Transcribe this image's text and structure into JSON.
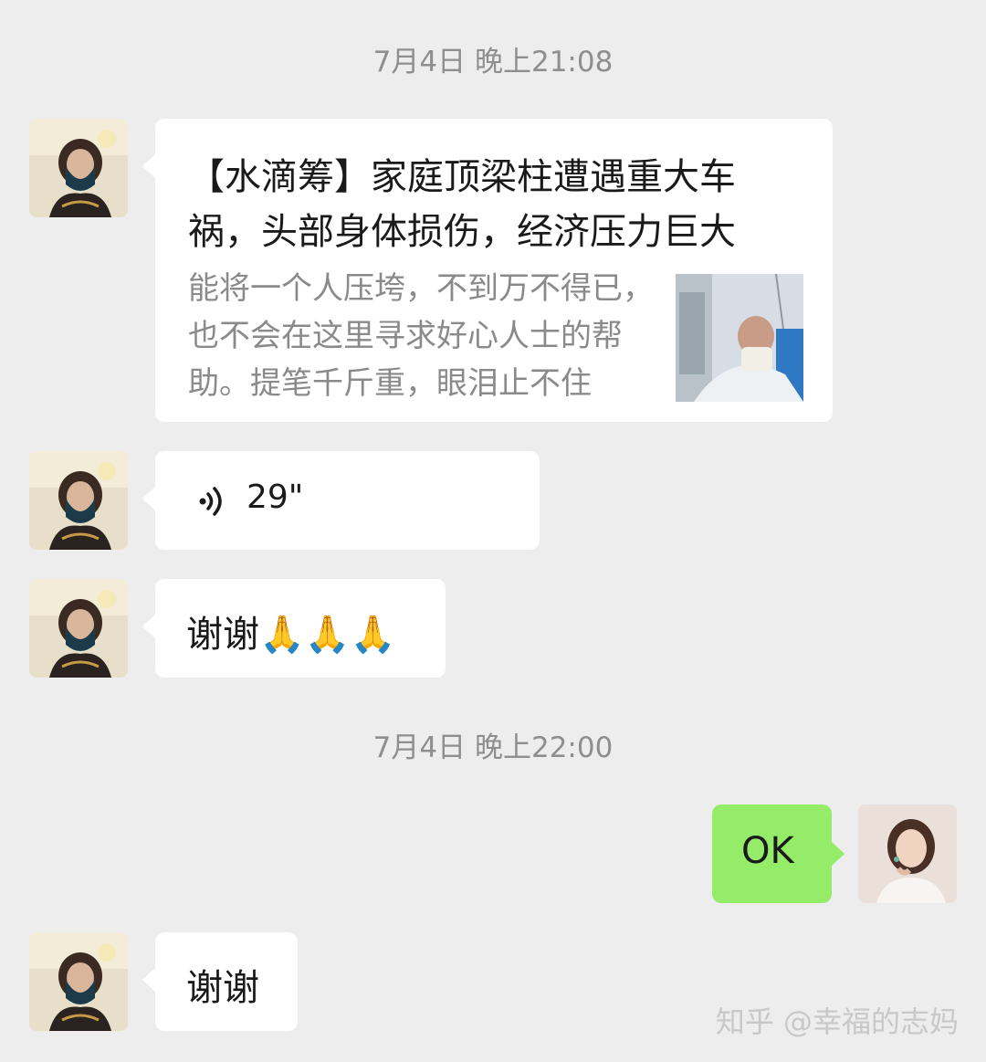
{
  "timestamps": [
    "7月4日 晚上21:08",
    "7月4日 晚上22:00"
  ],
  "messages": [
    {
      "type": "link-card",
      "title": "【水滴筹】家庭顶梁柱遭遇重大车祸，头部身体损伤，经济压力巨大",
      "description": "能将一个人压垮，不到万不得已，也不会在这里寻求好心人士的帮助。提笔千斤重，眼泪止不住"
    },
    {
      "type": "voice",
      "duration": "29\"",
      "icon": "voice-wave-icon"
    },
    {
      "type": "text",
      "text": "谢谢",
      "emoji": "🙏🙏🙏"
    },
    {
      "type": "text",
      "text": "OK",
      "side": "right"
    },
    {
      "type": "text",
      "text": "谢谢"
    }
  ],
  "watermark": "知乎 @幸福的志妈",
  "colors": {
    "background": "#ededed",
    "incoming_bubble": "#ffffff",
    "outgoing_bubble": "#95ec69",
    "timestamp_text": "#8e8e8e"
  }
}
